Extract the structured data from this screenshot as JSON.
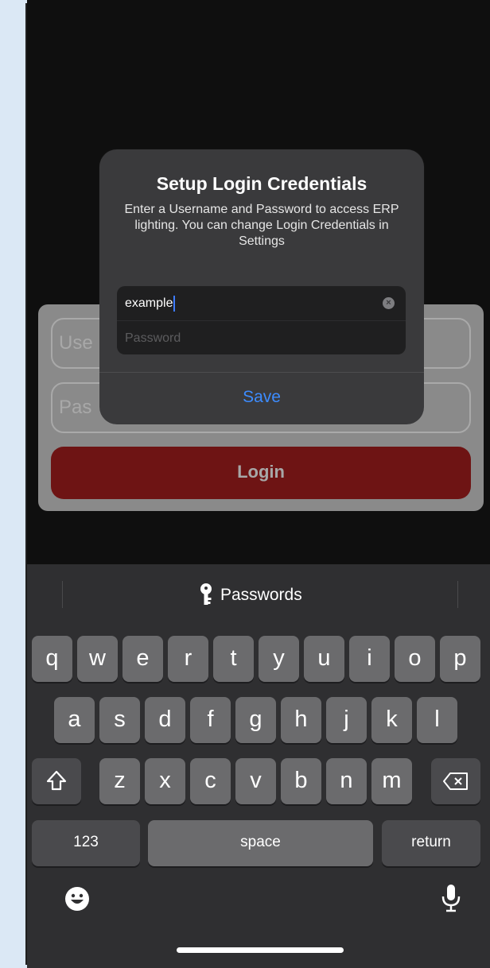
{
  "alert": {
    "title": "Setup Login Credentials",
    "message": "Enter a Username and Password to access ERP lighting. You can change Login Credentials in Settings",
    "username_value": "example",
    "password_placeholder": "Password",
    "save_label": "Save"
  },
  "login_form": {
    "username_placeholder": "Use",
    "password_placeholder": "Pas",
    "login_label": "Login"
  },
  "keyboard": {
    "suggestion": "Passwords",
    "row1": [
      "q",
      "w",
      "e",
      "r",
      "t",
      "y",
      "u",
      "i",
      "o",
      "p"
    ],
    "row2": [
      "a",
      "s",
      "d",
      "f",
      "g",
      "h",
      "j",
      "k",
      "l"
    ],
    "row3": [
      "z",
      "x",
      "c",
      "v",
      "b",
      "n",
      "m"
    ],
    "numbers_label": "123",
    "space_label": "space",
    "return_label": "return"
  },
  "colors": {
    "login_button": "#6e1414",
    "save_link": "#3d8cff",
    "caret": "#3d7bff"
  },
  "icons": [
    "key-icon",
    "clear-icon",
    "shift-icon",
    "backspace-icon",
    "emoji-icon",
    "mic-icon"
  ]
}
